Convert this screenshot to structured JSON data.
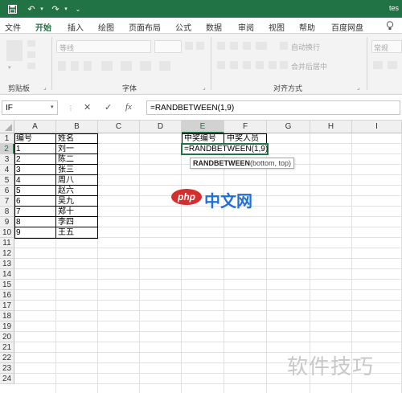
{
  "titlebar": {
    "doc_title": "tes",
    "save_icon": "save-icon",
    "undo_icon": "undo-icon",
    "redo_icon": "redo-icon"
  },
  "tabs": [
    "文件",
    "开始",
    "插入",
    "绘图",
    "页面布局",
    "公式",
    "数据",
    "审阅",
    "视图",
    "帮助",
    "百度网盘"
  ],
  "active_tab": "开始",
  "ribbon": {
    "groups": [
      "剪贴板",
      "字体",
      "对齐方式"
    ],
    "font_name": "等线",
    "wrap_text": "自动换行",
    "merge_center": "合并后居中",
    "right_box": "常规"
  },
  "formula_bar": {
    "name_box": "IF",
    "cancel": "✕",
    "enter": "✓",
    "fx": "fx",
    "formula": "=RANDBETWEEN(1,9)"
  },
  "columns": [
    "A",
    "B",
    "C",
    "D",
    "E",
    "F",
    "G",
    "H",
    "I"
  ],
  "rows": [
    "1",
    "2",
    "3",
    "4",
    "5",
    "6",
    "7",
    "8",
    "9",
    "10",
    "11",
    "12",
    "13",
    "14",
    "15",
    "16",
    "17",
    "18",
    "19",
    "20",
    "21",
    "22",
    "23",
    "24"
  ],
  "table": {
    "header": [
      "编号",
      "姓名"
    ],
    "rows": [
      [
        "1",
        "刘一"
      ],
      [
        "2",
        "陈二"
      ],
      [
        "3",
        "张三"
      ],
      [
        "4",
        "周八"
      ],
      [
        "5",
        "赵六"
      ],
      [
        "6",
        "吴九"
      ],
      [
        "7",
        "郑十"
      ],
      [
        "8",
        "李四"
      ],
      [
        "9",
        "王五"
      ]
    ]
  },
  "lottery": {
    "e1": "中奖编号",
    "f1": "中奖人员",
    "e2": "=RANDBETWEEN(1,9)"
  },
  "tooltip": {
    "func": "RANDBETWEEN",
    "args": "(bottom, top)"
  },
  "watermarks": {
    "php_logo": "php",
    "php_text": "中文网",
    "bottom_text": "软件技巧"
  },
  "colors": {
    "accent": "#217346",
    "php_blue": "#1f6fd8",
    "php_red": "#d42e2e"
  }
}
